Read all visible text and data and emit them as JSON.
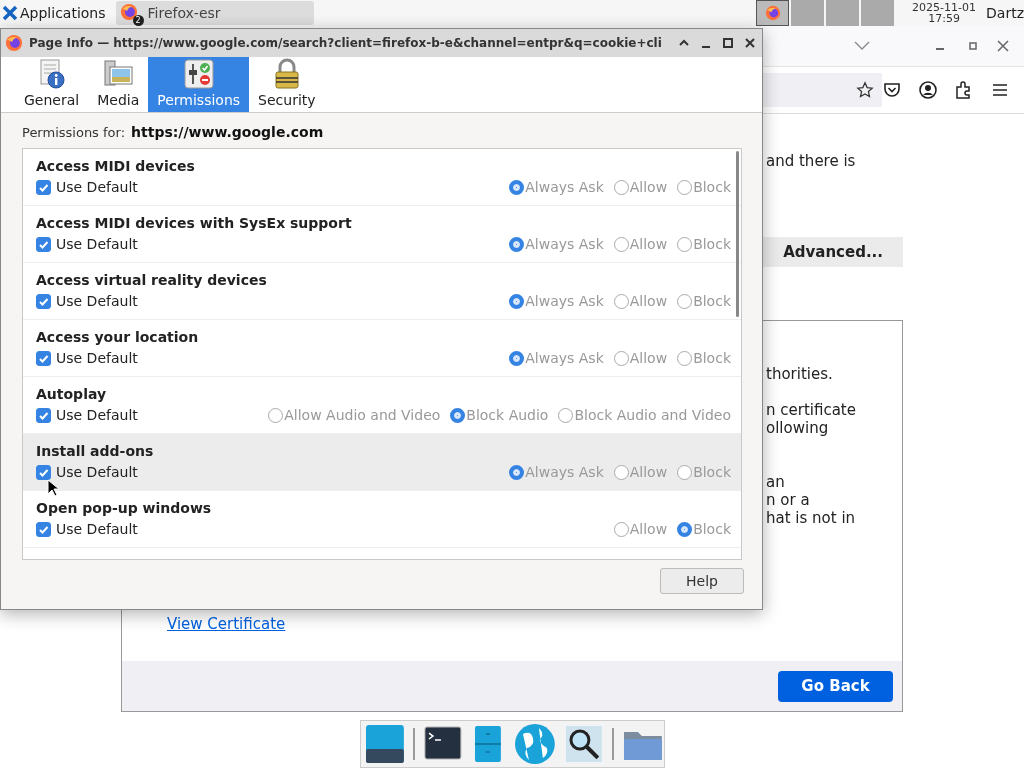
{
  "top_panel": {
    "applications": "Applications",
    "task": {
      "title": "Firefox-esr",
      "count": "2"
    },
    "clock": {
      "date": "2025-11-01",
      "time": "17:59"
    },
    "user": "Dartz"
  },
  "browser": {
    "intro_text": "and there is",
    "advanced_button": "Advanced...",
    "cert_paragraphs": [
      [
        "thorities."
      ],
      [
        "n certificate",
        "ollowing"
      ],
      [
        "an",
        "n or a",
        "hat is not in"
      ]
    ],
    "view_certificate": "View Certificate",
    "go_back": "Go Back"
  },
  "dialog": {
    "title": "Page Info — https://www.google.com/search?client=firefox-b-e&channel=entpr&q=cookie+cli",
    "tabs": [
      {
        "label": "General",
        "kind": "general",
        "selected": false
      },
      {
        "label": "Media",
        "kind": "media",
        "selected": false
      },
      {
        "label": "Permissions",
        "kind": "permissions",
        "selected": true
      },
      {
        "label": "Security",
        "kind": "security",
        "selected": false
      }
    ],
    "permissions_for_label": "Permissions for:",
    "site": "https://www.google.com",
    "permissions": [
      {
        "name": "Access MIDI devices",
        "use_default_label": "Use Default",
        "use_default": true,
        "highlighted": false,
        "options": [
          {
            "label": "Always Ask",
            "selected": true
          },
          {
            "label": "Allow",
            "selected": false
          },
          {
            "label": "Block",
            "selected": false
          }
        ]
      },
      {
        "name": "Access MIDI devices with SysEx support",
        "use_default_label": "Use Default",
        "use_default": true,
        "highlighted": false,
        "options": [
          {
            "label": "Always Ask",
            "selected": true
          },
          {
            "label": "Allow",
            "selected": false
          },
          {
            "label": "Block",
            "selected": false
          }
        ]
      },
      {
        "name": "Access virtual reality devices",
        "use_default_label": "Use Default",
        "use_default": true,
        "highlighted": false,
        "options": [
          {
            "label": "Always Ask",
            "selected": true
          },
          {
            "label": "Allow",
            "selected": false
          },
          {
            "label": "Block",
            "selected": false
          }
        ]
      },
      {
        "name": "Access your location",
        "use_default_label": "Use Default",
        "use_default": true,
        "highlighted": false,
        "options": [
          {
            "label": "Always Ask",
            "selected": true
          },
          {
            "label": "Allow",
            "selected": false
          },
          {
            "label": "Block",
            "selected": false
          }
        ]
      },
      {
        "name": "Autoplay",
        "use_default_label": "Use Default",
        "use_default": true,
        "highlighted": false,
        "options": [
          {
            "label": "Allow Audio and Video",
            "selected": false
          },
          {
            "label": "Block Audio",
            "selected": true
          },
          {
            "label": "Block Audio and Video",
            "selected": false
          }
        ]
      },
      {
        "name": "Install add-ons",
        "use_default_label": "Use Default",
        "use_default": true,
        "highlighted": true,
        "options": [
          {
            "label": "Always Ask",
            "selected": true
          },
          {
            "label": "Allow",
            "selected": false
          },
          {
            "label": "Block",
            "selected": false
          }
        ]
      },
      {
        "name": "Open pop-up windows",
        "use_default_label": "Use Default",
        "use_default": true,
        "highlighted": false,
        "options": [
          {
            "label": "Allow",
            "selected": false
          },
          {
            "label": "Block",
            "selected": true
          }
        ]
      }
    ],
    "help_button": "Help"
  }
}
